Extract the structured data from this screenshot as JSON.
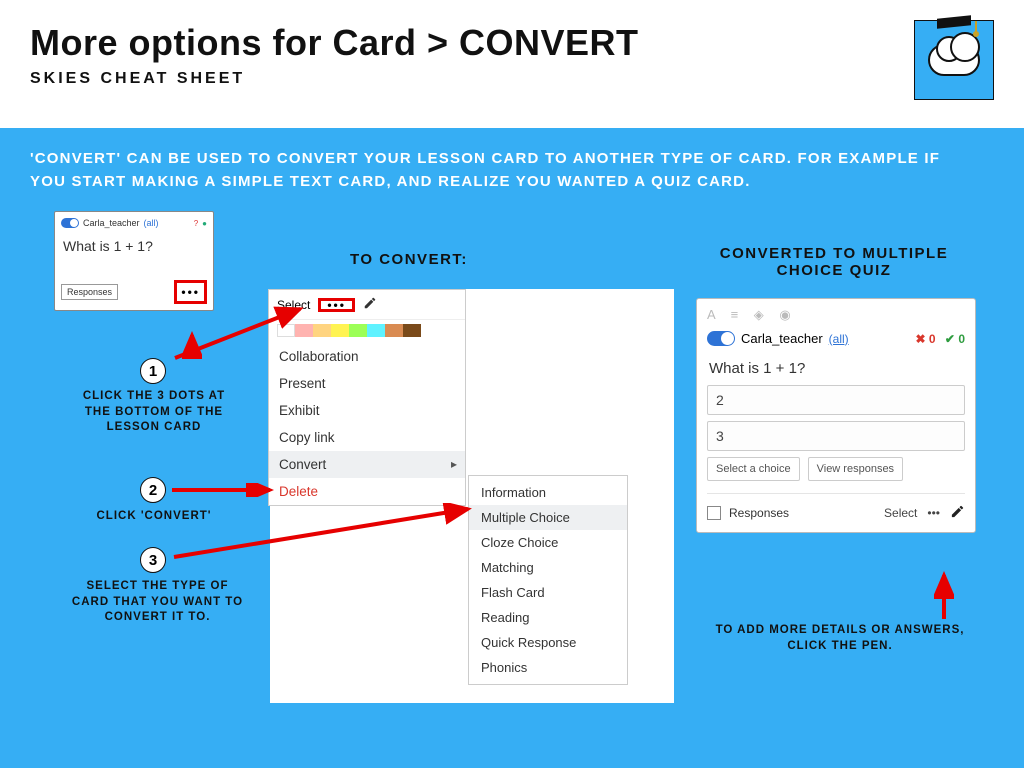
{
  "header": {
    "title": "More options for Card > CONVERT",
    "subtitle": "SKIES CHEAT SHEET"
  },
  "intro": "'CONVERT' CAN BE USED TO CONVERT YOUR LESSON CARD TO ANOTHER TYPE OF CARD. FOR EXAMPLE IF YOU START MAKING A SIMPLE TEXT CARD, AND REALIZE YOU WANTED A QUIZ CARD.",
  "sections": {
    "to_convert": "TO CONVERT:",
    "converted": "CONVERTED TO MULTIPLE CHOICE QUIZ"
  },
  "steps": {
    "s1_num": "1",
    "s1_text": "CLICK THE 3 DOTS AT THE BOTTOM OF THE LESSON CARD",
    "s2_num": "2",
    "s2_text": "CLICK 'CONVERT'",
    "s3_num": "3",
    "s3_text": "SELECT THE TYPE OF CARD THAT YOU WANT TO CONVERT IT TO."
  },
  "card1": {
    "author": "Carla_teacher",
    "author_tag": "(all)",
    "question": "What is 1 + 1?",
    "responses": "Responses",
    "dots": "•••"
  },
  "menu": {
    "select": "Select",
    "dots": "•••",
    "items": {
      "collaboration": "Collaboration",
      "present": "Present",
      "exhibit": "Exhibit",
      "copylink": "Copy link",
      "convert": "Convert",
      "delete": "Delete"
    }
  },
  "submenu": {
    "information": "Information",
    "multiple": "Multiple Choice",
    "cloze": "Cloze Choice",
    "matching": "Matching",
    "flash": "Flash Card",
    "reading": "Reading",
    "quick": "Quick Response",
    "phonics": "Phonics"
  },
  "card2": {
    "author": "Carla_teacher",
    "all": "(all)",
    "x_count": "0",
    "v_count": "0",
    "question": "What is 1 + 1?",
    "opt1": "2",
    "opt2": "3",
    "select_choice": "Select a choice",
    "view_responses": "View responses",
    "responses": "Responses",
    "select": "Select",
    "dots": "•••"
  },
  "pen_tip": "TO ADD MORE DETAILS OR ANSWERS, CLICK THE PEN.",
  "colors": [
    "#ffffff",
    "#ffb3b0",
    "#ffd480",
    "#fff352",
    "#9cff57",
    "#5ff2ff",
    "#d98b52",
    "#7a4a1a"
  ]
}
